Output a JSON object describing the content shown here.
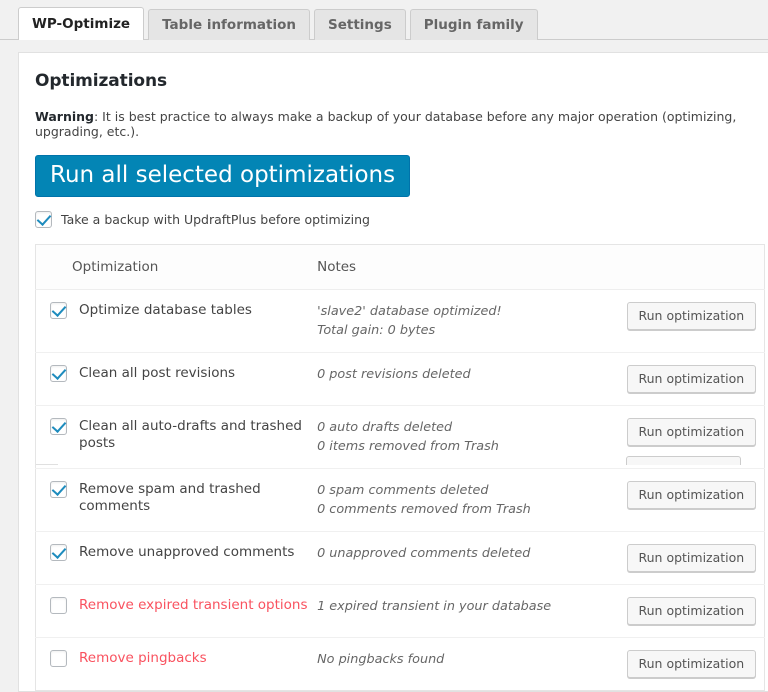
{
  "tabs": [
    {
      "label": "WP-Optimize",
      "active": true
    },
    {
      "label": "Table information",
      "active": false
    },
    {
      "label": "Settings",
      "active": false
    },
    {
      "label": "Plugin family",
      "active": false
    }
  ],
  "panel": {
    "title": "Optimizations",
    "warning_label": "Warning",
    "warning_text": ": It is best practice to always make a backup of your database before any major operation (optimizing, upgrading, etc.).",
    "run_all_label": "Run all selected optimizations",
    "backup_checkbox_label": "Take a backup with UpdraftPlus before optimizing",
    "backup_checkbox_checked": true
  },
  "table": {
    "headers": {
      "optimization": "Optimization",
      "notes": "Notes",
      "action": ""
    },
    "rows": [
      {
        "checked": true,
        "danger": false,
        "label": "Optimize database tables",
        "notes": [
          "'slave2' database optimized!",
          "Total gain: 0 bytes"
        ],
        "button": "Run optimization"
      },
      {
        "checked": true,
        "danger": false,
        "label": "Clean all post revisions",
        "notes": [
          "0 post revisions deleted"
        ],
        "button": "Run optimization"
      },
      {
        "checked": true,
        "danger": false,
        "label": "Clean all auto-drafts and trashed posts",
        "notes": [
          "0 auto drafts deleted",
          "0 items removed from Trash"
        ],
        "button": "Run optimization"
      },
      {
        "checked": true,
        "danger": false,
        "label": "Remove spam and trashed comments",
        "notes": [
          "0 spam comments deleted",
          "0 comments removed from Trash"
        ],
        "button": "Run optimization"
      },
      {
        "checked": true,
        "danger": false,
        "label": "Remove unapproved comments",
        "notes": [
          "0 unapproved comments deleted"
        ],
        "button": "Run optimization"
      },
      {
        "checked": false,
        "danger": true,
        "label": "Remove expired transient options",
        "notes": [
          "1 expired transient in your database"
        ],
        "button": "Run optimization"
      },
      {
        "checked": false,
        "danger": true,
        "label": "Remove pingbacks",
        "notes": [
          "No pingbacks found"
        ],
        "button": "Run optimization"
      }
    ]
  },
  "colors": {
    "primary_button": "#0385b5",
    "danger_text": "#f9525f",
    "checkbox_check": "#1e8cbe",
    "page_background": "#f1f1f1"
  }
}
